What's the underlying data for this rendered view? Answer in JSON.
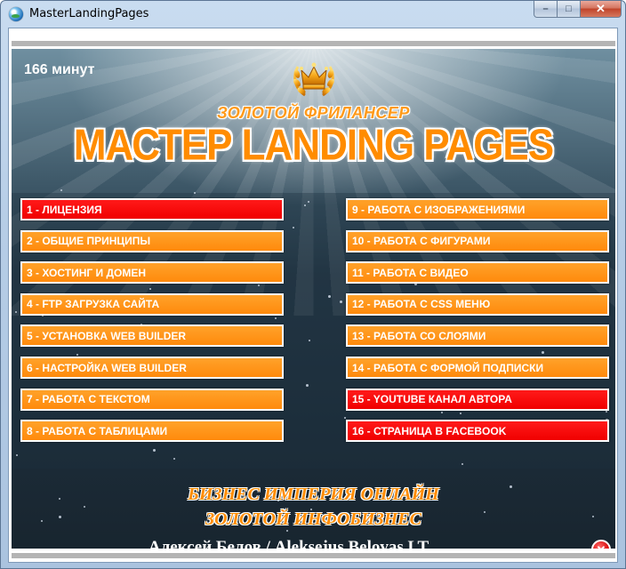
{
  "window": {
    "title": "MasterLandingPages",
    "minimize_glyph": "–",
    "maximize_glyph": "□",
    "close_glyph": "✕"
  },
  "header": {
    "timer": "166 минут",
    "subtitle": "ЗОЛОТОЙ ФРИЛАНСЕР",
    "title": "МАСТЕР LANDING PAGES",
    "logo_icon": "crown-laurel-icon"
  },
  "menu": {
    "left": [
      {
        "label": "1 - ЛИЦЕНЗИЯ",
        "style": "red"
      },
      {
        "label": "2 - ОБЩИЕ ПРИНЦИПЫ",
        "style": "orange"
      },
      {
        "label": "3 - ХОСТИНГ И ДОМЕН",
        "style": "orange"
      },
      {
        "label": "4 - FTP ЗАГРУЗКА САЙТА",
        "style": "orange"
      },
      {
        "label": "5 - УСТАНОВКА WEB BUILDER",
        "style": "orange"
      },
      {
        "label": "6 - НАСТРОЙКА WEB BUILDER",
        "style": "orange"
      },
      {
        "label": "7 - РАБОТА С ТЕКСТОМ",
        "style": "orange"
      },
      {
        "label": "8 - РАБОТА С ТАБЛИЦАМИ",
        "style": "orange"
      }
    ],
    "right": [
      {
        "label": "9 - РАБОТА С ИЗОБРАЖЕНИЯМИ",
        "style": "orange"
      },
      {
        "label": "10 - РАБОТА С ФИГУРАМИ",
        "style": "orange"
      },
      {
        "label": "11 - РАБОТА С ВИДЕО",
        "style": "orange"
      },
      {
        "label": "12 - РАБОТА С CSS МЕНЮ",
        "style": "orange"
      },
      {
        "label": "13 - РАБОТА СО СЛОЯМИ",
        "style": "orange"
      },
      {
        "label": "14 - РАБОТА С ФОРМОЙ ПОДПИСКИ",
        "style": "orange"
      },
      {
        "label": "15 - YOUTUBE КАНАЛ АВТОРА",
        "style": "red"
      },
      {
        "label": "16 - СТРАНИЦА В FACEBOOK",
        "style": "red"
      }
    ]
  },
  "footer": {
    "line1": "БИЗНЕС ИМПЕРИЯ ОНЛАЙН",
    "line2": "ЗОЛОТОЙ ИНФОБИЗНЕС",
    "author": "Алексей Белов / Aleksejus Belovas LT",
    "close_glyph": "✕"
  },
  "colors": {
    "orange": "#ff8c00",
    "red": "#ff0000",
    "background_dark": "#1d2d3a"
  }
}
